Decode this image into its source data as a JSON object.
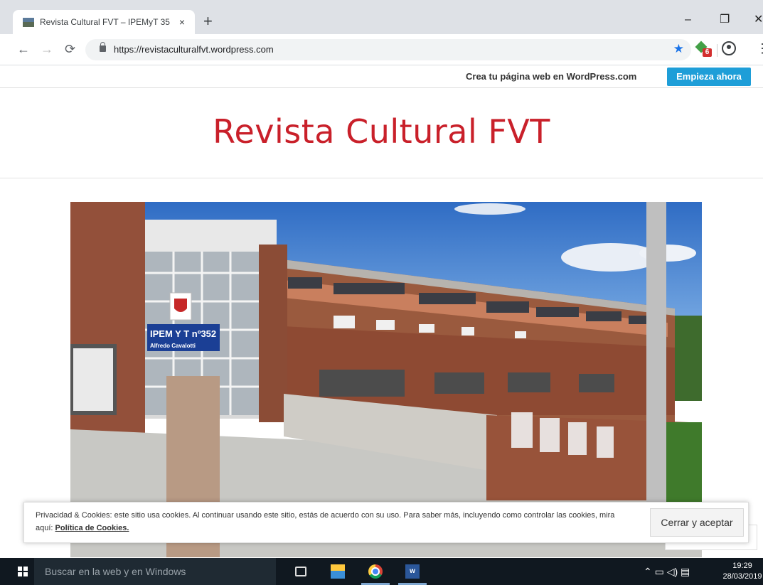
{
  "browser": {
    "tab_title": "Revista Cultural FVT – IPEMyT 35",
    "new_tab": "+",
    "close_tab": "×",
    "url": "https://revistaculturalfvt.wordpress.com",
    "extension_badge": "6",
    "window_controls": {
      "minimize": "–",
      "restore": "❐",
      "close": "✕"
    }
  },
  "wordpress_bar": {
    "text": "Crea tu página web en WordPress.com",
    "button": "Empieza ahora"
  },
  "site": {
    "title": "Revista Cultural FVT"
  },
  "photo": {
    "sign_line1": "IPEM Y T nº352",
    "sign_line2": "Alfredo Cavalotti"
  },
  "cookie_banner": {
    "text": "Privacidad & Cookies: este sitio usa cookies. Al continuar usando este sitio, estás de acuerdo con su uso. Para saber más, incluyendo como controlar las cookies, mira aquí: ",
    "link": "Política de Cookies.",
    "button": "Cerrar y aceptar"
  },
  "taskbar": {
    "search_placeholder": "Buscar en la web y en Windows",
    "time": "19:29",
    "date": "28/03/2019",
    "word_label": "w"
  }
}
